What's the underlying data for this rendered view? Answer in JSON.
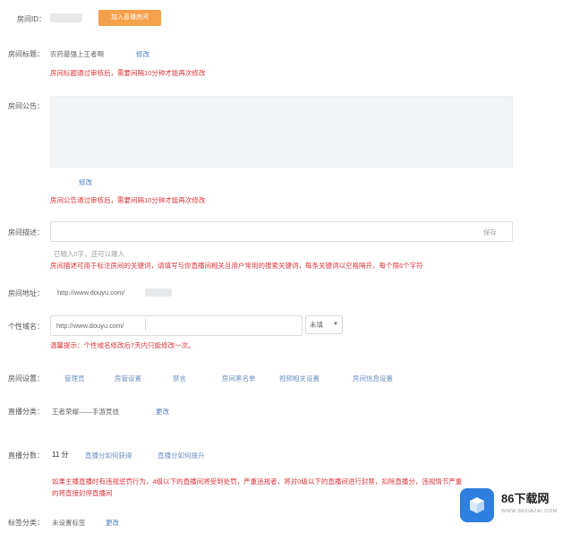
{
  "room_id": {
    "label": "房间ID：",
    "join_button": "加入直播房间"
  },
  "room_title": {
    "label": "房间标题：",
    "value": "农药最强上王者啊",
    "edit": "修改",
    "hint": "房间标题通过审核后，需要间隔10分钟才能再次修改"
  },
  "room_notice": {
    "label": "房间公告：",
    "edit": "修改",
    "hint": "房间公告通过审核后，需要间隔10分钟才能再次修改"
  },
  "room_desc": {
    "label": "房间描述：",
    "save": "保存",
    "counter": "已输入0字，还可以输入",
    "hint": "房间描述可用于标注房间的关键词，请填写与你直播间相关且用户常用的搜索关键词，每条关键词以空格隔开，每个限6个字符"
  },
  "room_url": {
    "label": "房间地址：",
    "value": "http://www.douyu.com/"
  },
  "custom_url": {
    "label": "个性域名：",
    "prefix": "http://www.douyu.com/",
    "status": "未填",
    "hint": "温馨提示：个性域名修改后7天内只能修改一次。"
  },
  "room_settings": {
    "label": "房间设置：",
    "items": [
      "管理员",
      "房管设置",
      "禁言",
      "房间黑名单",
      "视频相关设置",
      "房间信息设置"
    ]
  },
  "live_category": {
    "label": "直播分类：",
    "value": "王者荣耀——手游竞技",
    "edit": "更改"
  },
  "live_score": {
    "label": "直播分数：",
    "value": "11 分",
    "link1": "直播分如何获得",
    "link2": "直播分如何提升",
    "hint": "如果主播直播时有违规惩罚行为，4级以下的直播间将受到处罚，严重违规者，将对0级以下的直播间进行封禁，扣除直播分，违规情节严重的将直接封停直播间"
  },
  "tag_category": {
    "label": "标签分类：",
    "value": "未设置标签",
    "edit": "更改"
  },
  "watermark": {
    "brand": "86下载网",
    "sub": "WWW.86XIAZAI.COM"
  },
  "colors": {
    "accent": "#f5a04a",
    "hint": "#d9363e",
    "link": "#4d7fb8",
    "brand": "#2f7fe0"
  }
}
